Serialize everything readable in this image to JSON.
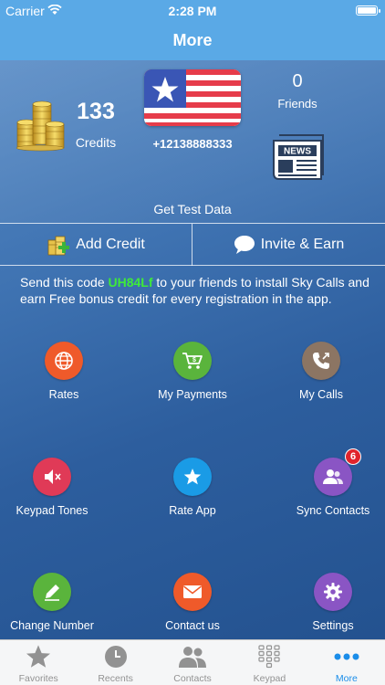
{
  "status": {
    "carrier": "Carrier",
    "time": "2:28 PM"
  },
  "title": "More",
  "header": {
    "credits_value": "133",
    "credits_label": "Credits",
    "phone": "+12138888333",
    "friends_value": "0",
    "friends_label": "Friends",
    "news_label": "NEWS",
    "test_data": "Get Test Data"
  },
  "actions": {
    "add_credit": "Add Credit",
    "invite": "Invite & Earn"
  },
  "invite": {
    "prefix": "Send this code",
    "code": "UH84Lf",
    "suffix": "to your friends to install Sky Calls and earn Free bonus credit for every registration in the app."
  },
  "grid": [
    {
      "label": "Rates",
      "icon": "globe-icon",
      "color": "#ef5a2a"
    },
    {
      "label": "My Payments",
      "icon": "cart-icon",
      "color": "#5ab43c"
    },
    {
      "label": "My Calls",
      "icon": "phone-icon",
      "color": "#8c7563"
    },
    {
      "label": "Keypad Tones",
      "icon": "speaker-icon",
      "color": "#e03a57"
    },
    {
      "label": "Rate App",
      "icon": "star-icon",
      "color": "#1a9be6"
    },
    {
      "label": "Sync Contacts",
      "icon": "people-icon",
      "color": "#8a55c4",
      "badge": "6"
    },
    {
      "label": "Change Number",
      "icon": "pencil-icon",
      "color": "#5ab43c"
    },
    {
      "label": "Contact us",
      "icon": "mail-icon",
      "color": "#ef5a2a"
    },
    {
      "label": "Settings",
      "icon": "gear-icon",
      "color": "#8a55c4"
    }
  ],
  "tabs": [
    {
      "label": "Favorites",
      "icon": "star-icon"
    },
    {
      "label": "Recents",
      "icon": "clock-icon"
    },
    {
      "label": "Contacts",
      "icon": "contacts-icon"
    },
    {
      "label": "Keypad",
      "icon": "keypad-icon"
    },
    {
      "label": "More",
      "icon": "more-icon",
      "active": true
    }
  ],
  "colors": {
    "bar": "#5aa9e6",
    "code": "#3eea3a",
    "active_tab": "#1a8de9",
    "badge": "#e0242c"
  }
}
